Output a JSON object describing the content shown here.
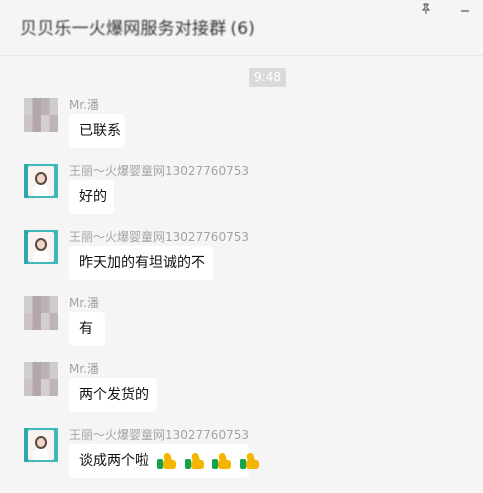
{
  "window": {
    "title": "贝贝乐一火爆网服务对接群",
    "member_count": "(6)",
    "pin_icon": "pin-icon",
    "minimize_icon": "minimize-icon"
  },
  "chat": {
    "time": "9:48",
    "messages": [
      {
        "sender": "Mr.潘",
        "text": "已联系",
        "avatar_icon": "pixelated-avatar"
      },
      {
        "sender": "王丽～火爆婴童网13027760753",
        "text": "好的",
        "avatar_icon": "photo-avatar"
      },
      {
        "sender": "王丽～火爆婴童网13027760753",
        "text": "昨天加的有坦诚的不",
        "avatar_icon": "photo-avatar"
      },
      {
        "sender": "Mr.潘",
        "text": "有",
        "avatar_icon": "pixelated-avatar"
      },
      {
        "sender": "Mr.潘",
        "text": "两个发货的",
        "avatar_icon": "pixelated-avatar"
      },
      {
        "sender": "王丽～火爆婴童网13027760753",
        "text": "谈成两个啦",
        "avatar_icon": "photo-avatar",
        "emoji": [
          "thumbs-up-icon",
          "thumbs-up-icon",
          "thumbs-up-icon",
          "thumbs-up-icon"
        ]
      }
    ]
  }
}
